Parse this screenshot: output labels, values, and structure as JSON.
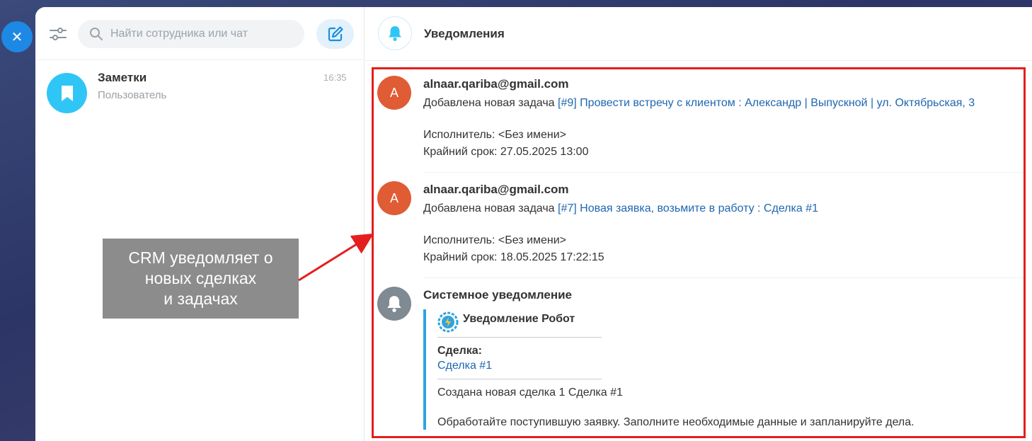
{
  "close_button": {
    "icon": "close-icon",
    "glyph": "✕"
  },
  "search": {
    "placeholder": "Найти сотрудника или чат"
  },
  "chat_list": [
    {
      "title": "Заметки",
      "subtitle": "Пользователь",
      "time": "16:35",
      "icon": "bookmark-icon"
    }
  ],
  "header": {
    "title": "Уведомления",
    "icon": "bell-icon"
  },
  "notifications": [
    {
      "avatar_letter": "A",
      "from": "alnaar.qariba@gmail.com",
      "prefix": "Добавлена новая задача",
      "link": "[#9] Провести встречу с клиентом : Александр | Выпускной | ул. Октябрьская, 3",
      "assignee": "Исполнитель: <Без имени>",
      "deadline": "Крайний срок: 27.05.2025 13:00"
    },
    {
      "avatar_letter": "A",
      "from": "alnaar.qariba@gmail.com",
      "prefix": "Добавлена новая задача",
      "link": "[#7] Новая заявка, возьмите в работу : Сделка #1",
      "assignee": "Исполнитель: <Без имени>",
      "deadline": "Крайний срок: 18.05.2025 17:22:15"
    }
  ],
  "system_notification": {
    "title": "Системное уведомление",
    "robot_title": "Уведомление Робот",
    "deal_label": "Сделка:",
    "deal_link": "Сделка #1",
    "created_text": "Создана новая сделка 1 Сделка #1",
    "instruction": "Обработайте поступившую заявку. Заполните необходимые данные и запланируйте дела."
  },
  "annotation": {
    "text": "CRM уведомляет о\nновых сделках\nи задачах",
    "frame_color": "#e41e1e",
    "box_color": "#8c8c8c"
  },
  "colors": {
    "accent": "#2fc6f6",
    "link": "#2067b0",
    "avatar": "#e05c34"
  }
}
